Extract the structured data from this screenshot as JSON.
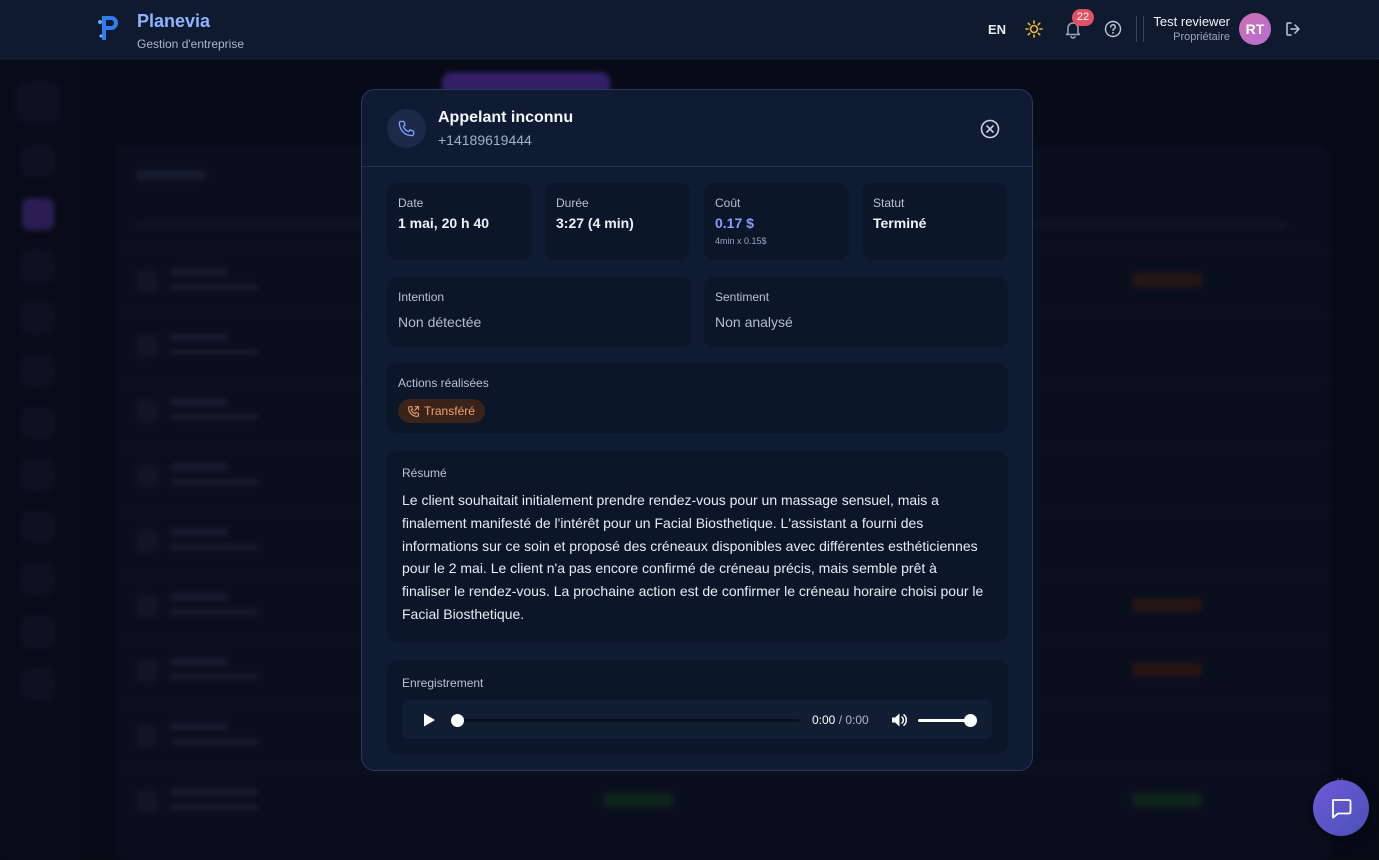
{
  "header": {
    "brand": "Planevia",
    "brand_sub": "Gestion d'entreprise",
    "lang": "EN",
    "notif_count": "22",
    "user_name": "Test reviewer",
    "user_role": "Propriétaire",
    "avatar_initials": "RT",
    "icons": [
      "sun-icon",
      "bell-icon",
      "help-icon",
      "logout-icon"
    ]
  },
  "modal": {
    "title": "Appelant inconnu",
    "phone": "+14189619444",
    "stats": [
      {
        "label": "Date",
        "value": "1 mai, 20 h 40"
      },
      {
        "label": "Durée",
        "value": "3:27 (4 min)"
      },
      {
        "label": "Coût",
        "value": "0.17 $",
        "sub": "4min x 0.15$"
      },
      {
        "label": "Statut",
        "value": "Terminé"
      }
    ],
    "intent": {
      "label": "Intention",
      "value": "Non détectée"
    },
    "sentiment": {
      "label": "Sentiment",
      "value": "Non analysé"
    },
    "actions": {
      "label": "Actions réalisées",
      "chip": "Transféré"
    },
    "summary": {
      "label": "Résumé",
      "text": "Le client souhaitait initialement prendre rendez-vous pour un massage sensuel, mais a finalement manifesté de l'intérêt pour un Facial Biosthetique. L'assistant a fourni des informations sur ce soin et proposé des créneaux disponibles avec différentes esthéticiennes pour le 2 mai. Le client n'a pas encore confirmé de créneau précis, mais semble prêt à finaliser le rendez-vous. La prochaine action est de confirmer le créneau horaire choisi pour le Facial Biosthetique."
    },
    "recording": {
      "label": "Enregistrement",
      "current": "0:00",
      "separator": " / ",
      "total": "0:00",
      "progress": 0,
      "volume": 1
    }
  },
  "colors": {
    "accent": "#8a9dff",
    "chip_bg": "#3a2419",
    "chip_text": "#f0a06a",
    "badge": "#e05263"
  }
}
